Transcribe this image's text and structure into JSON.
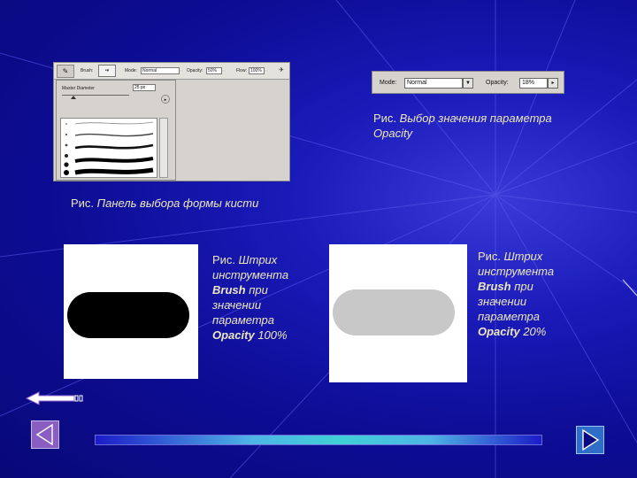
{
  "slide": {
    "background_color": "#0d0d96",
    "caption_color": "#ece7c2"
  },
  "brush_panel": {
    "brush_label": "Brush:",
    "mode_label": "Mode:",
    "mode_value": "Normal",
    "opacity_label": "Opacity:",
    "opacity_value": "50%",
    "flow_label": "Flow:",
    "flow_value": "100%",
    "master_diameter_label": "Master Diameter",
    "diameter_value": "25 px"
  },
  "opacity_toolbar": {
    "mode_label": "Mode:",
    "mode_value": "Normal",
    "opacity_label": "Opacity:",
    "opacity_value": "18%"
  },
  "captions": {
    "opacity_choice": {
      "prefix": "Рис.",
      "text": "Выбор значения параметра",
      "line2": "Opacity"
    },
    "brush_panel": {
      "prefix": "Рис.",
      "text": "Панель выбора формы кисти"
    },
    "stroke_100": {
      "prefix": "Рис.",
      "l1": "Штрих",
      "l2": "инструмента",
      "tool": "Brush",
      "l3": "при",
      "l4": "значении",
      "l5": "параметра",
      "param": "Opacity",
      "value": "100%"
    },
    "stroke_20": {
      "prefix": "Рис.",
      "l1": "Штрих",
      "l2": "инструмента",
      "tool": "Brush",
      "l3": "при",
      "l4": "значении",
      "l5": "параметра",
      "param": "Opacity",
      "value": "20%"
    }
  },
  "strokes": {
    "opacity_100_color": "#000000",
    "opacity_20_color": "#c8c8c8"
  },
  "navigation": {
    "prev_icon": "triangle-left-icon",
    "next_icon": "triangle-right-icon",
    "back_icon": "back-arrow-icon"
  }
}
